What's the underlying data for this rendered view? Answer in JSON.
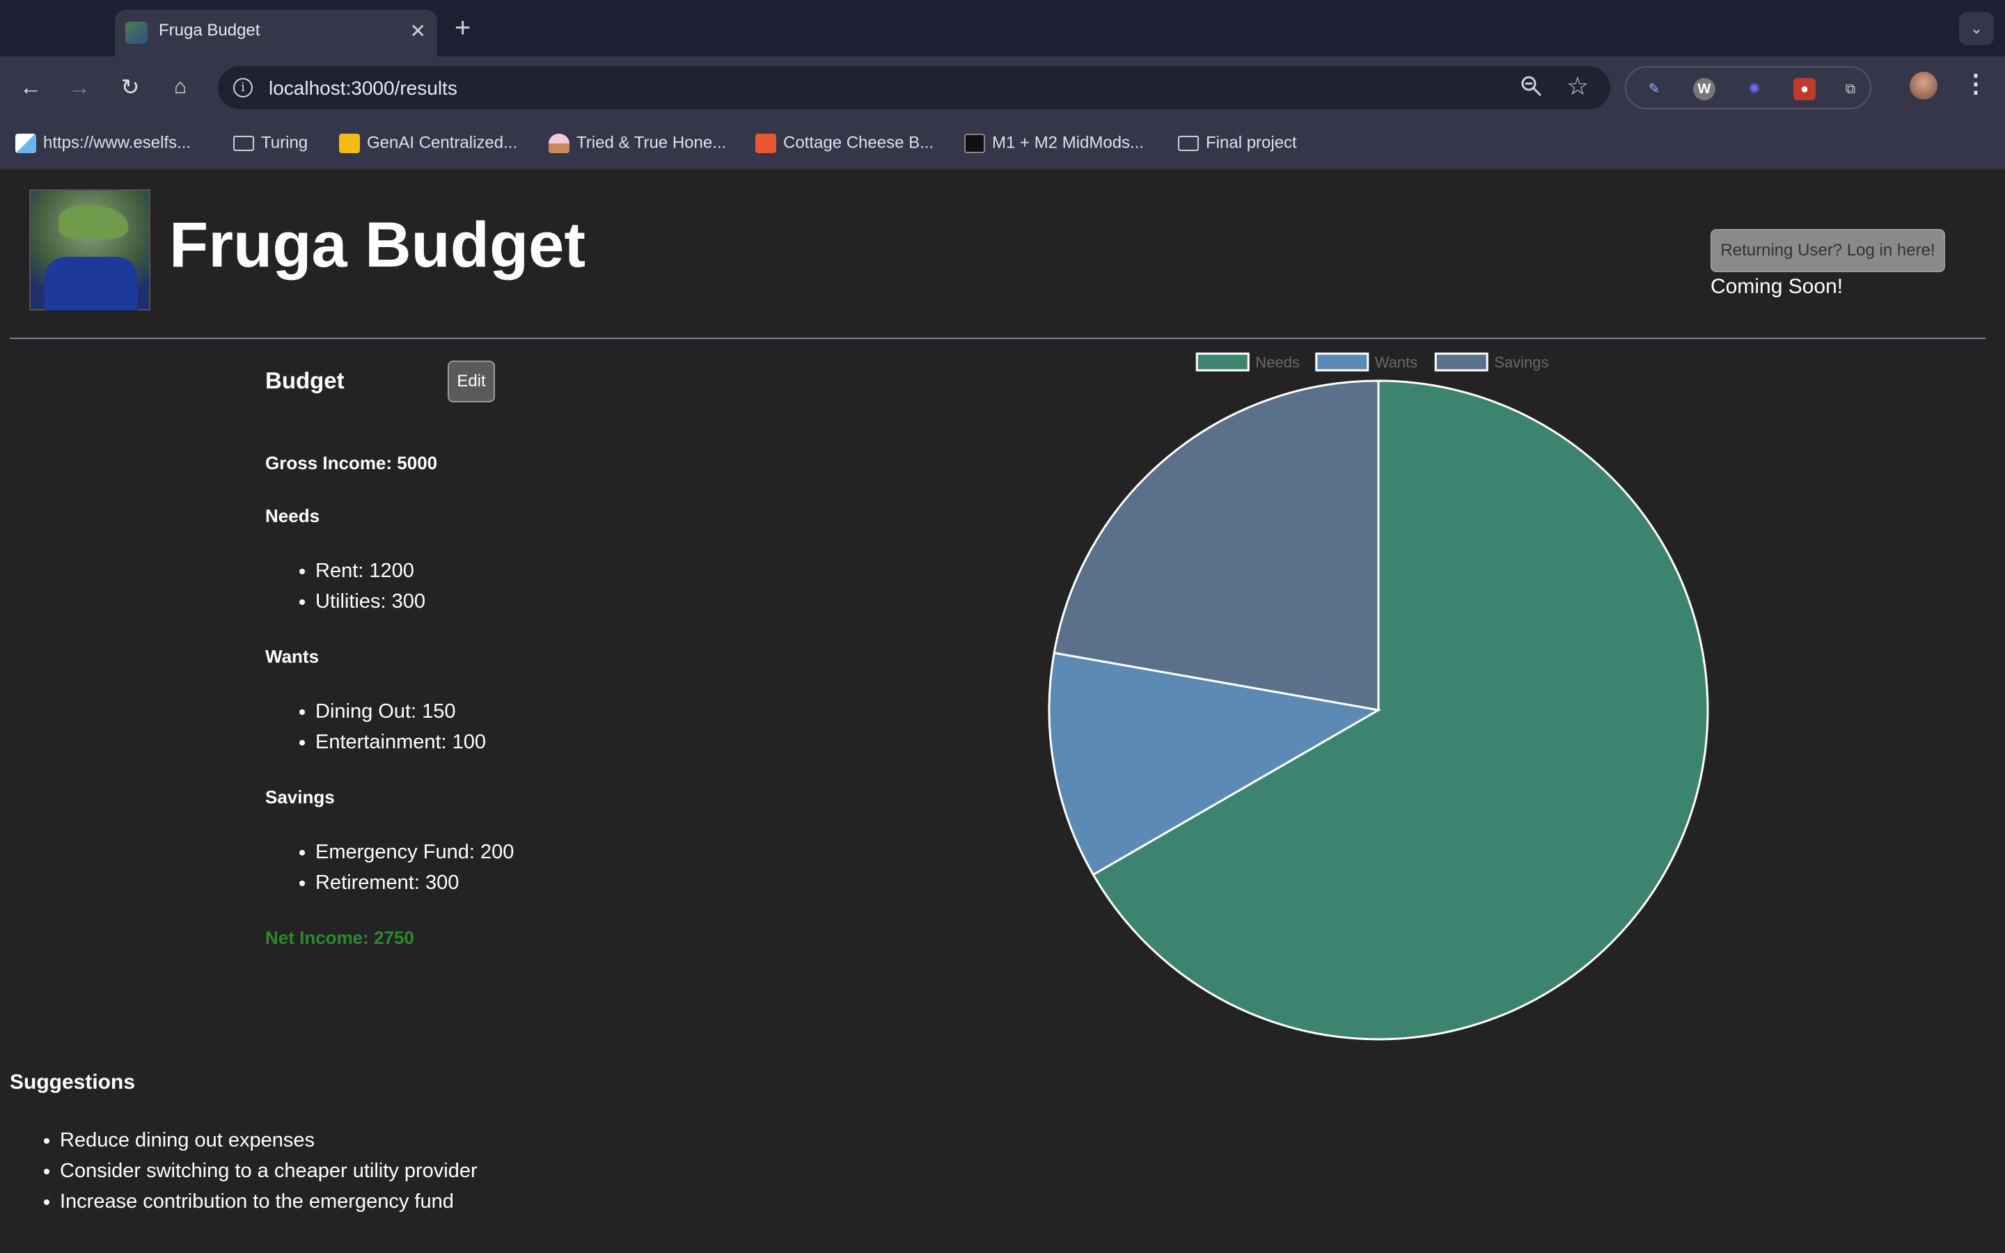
{
  "browser": {
    "tab_title": "Fruga Budget",
    "close_glyph": "✕",
    "new_tab_glyph": "+",
    "url": "localhost:3000/results",
    "bookmarks": [
      {
        "label": "https://www.eselfs...",
        "icon": "paper-plane-icon"
      },
      {
        "label": "Turing",
        "icon": "folder-icon"
      },
      {
        "label": "GenAI Centralized...",
        "icon": "slides-icon"
      },
      {
        "label": "Tried & True Hone...",
        "icon": "cupcake-icon"
      },
      {
        "label": "Cottage Cheese B...",
        "icon": "bookmark-ribbon-icon"
      },
      {
        "label": "M1 + M2 MidMods...",
        "icon": "laptop-icon"
      },
      {
        "label": "Final project",
        "icon": "folder-icon"
      }
    ]
  },
  "header": {
    "title": "Fruga Budget",
    "login_button": "Returning User? Log in here!",
    "coming_soon": "Coming Soon!"
  },
  "budget": {
    "heading": "Budget",
    "edit_label": "Edit",
    "gross_income": "Gross Income: 5000",
    "needs_heading": "Needs",
    "needs_items": [
      "Rent: 1200",
      "Utilities: 300"
    ],
    "wants_heading": "Wants",
    "wants_items": [
      "Dining Out: 150",
      "Entertainment: 100"
    ],
    "savings_heading": "Savings",
    "savings_items": [
      "Emergency Fund: 200",
      "Retirement: 300"
    ],
    "net_income": "Net Income: 2750"
  },
  "suggestions": {
    "heading": "Suggestions",
    "items": [
      "Reduce dining out expenses",
      "Consider switching to a cheaper utility provider",
      "Increase contribution to the emergency fund"
    ]
  },
  "colors": {
    "needs": "#3d8470",
    "wants": "#5b8ab5",
    "savings": "#5a708b",
    "net_income": "#2c8a2c",
    "divider": "#6d86a8"
  },
  "chart_data": {
    "type": "pie",
    "categories": [
      "Needs",
      "Wants",
      "Savings"
    ],
    "values": [
      1500,
      250,
      500
    ],
    "legend_position": "top"
  }
}
